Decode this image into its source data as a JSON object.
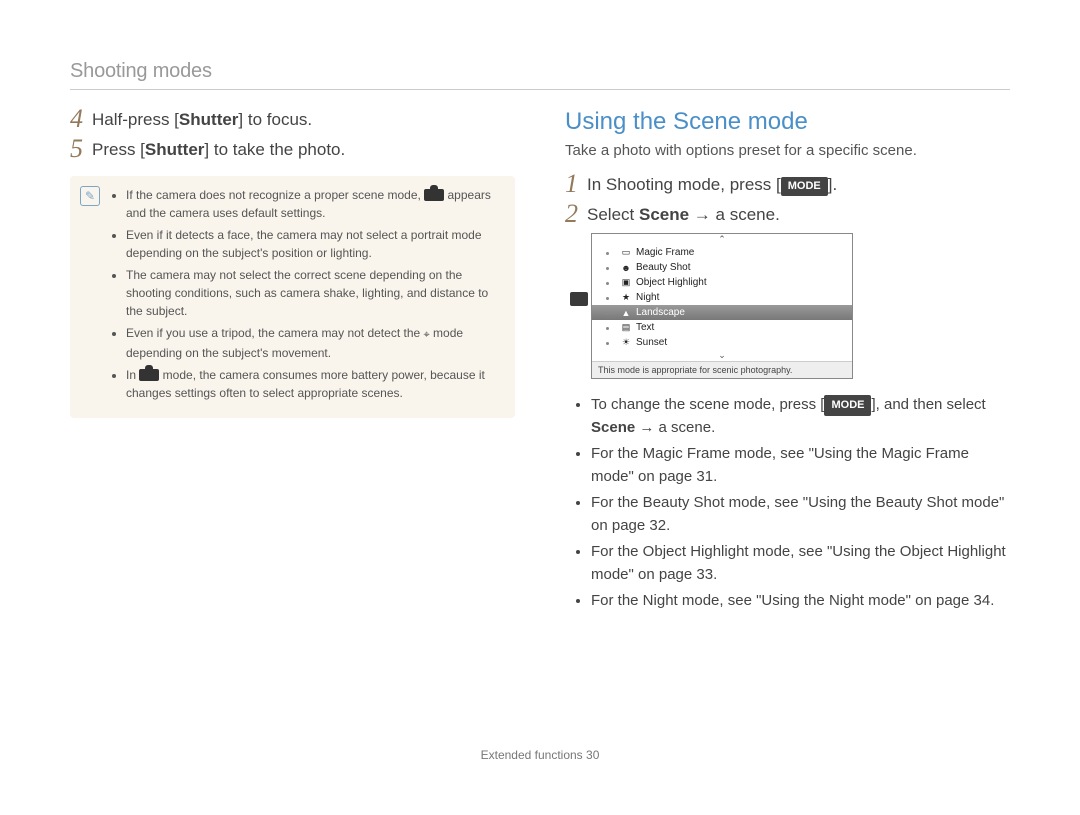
{
  "header": "Shooting modes",
  "left": {
    "steps": [
      {
        "num": "4",
        "parts": [
          "Half-press [",
          "Shutter",
          "] to focus."
        ]
      },
      {
        "num": "5",
        "parts": [
          "Press [",
          "Shutter",
          "] to take the photo."
        ]
      }
    ],
    "notes": [
      {
        "pre": "If the camera does not recognize a proper scene mode, ",
        "icon": "smart-auto-icon",
        "post": " appears and the camera uses default settings."
      },
      {
        "pre": "Even if it detects a face, the camera may not select a portrait mode depending on the subject's position or lighting."
      },
      {
        "pre": "The camera may not select the correct scene depending on the shooting conditions, such as camera shake, lighting, and distance to the subject."
      },
      {
        "pre": "Even if you use a tripod, the camera may not detect the ",
        "icon": "tripod-icon",
        "post": " mode depending on the subject's movement."
      },
      {
        "pre": "In ",
        "icon": "smart-auto-icon",
        "post": " mode, the camera consumes more battery power, because it changes settings often to select appropriate scenes."
      }
    ]
  },
  "right": {
    "title": "Using the Scene mode",
    "intro": "Take a photo with options preset for a specific scene.",
    "steps": [
      {
        "num": "1",
        "pre": "In Shooting mode, press [",
        "mode": "MODE",
        "post": "]."
      },
      {
        "num": "2",
        "pre": "Select ",
        "bold": "Scene",
        "post": " → a scene."
      }
    ],
    "scene": {
      "items": [
        {
          "ico": "▭",
          "label": "Magic Frame"
        },
        {
          "ico": "☻",
          "label": "Beauty Shot"
        },
        {
          "ico": "▣",
          "label": "Object Highlight"
        },
        {
          "ico": "★",
          "label": "Night"
        },
        {
          "ico": "▲",
          "label": "Landscape",
          "selected": true
        },
        {
          "ico": "▤",
          "label": "Text"
        },
        {
          "ico": "☀",
          "label": "Sunset"
        }
      ],
      "caption": "This mode is appropriate for scenic photography."
    },
    "bullets": [
      {
        "pre": "To change the scene mode, press [",
        "mode": "MODE",
        "mid": "], and then select ",
        "bold": "Scene",
        "post": " → a scene."
      },
      {
        "pre": "For the Magic Frame mode, see \"Using the Magic Frame mode\" on page 31."
      },
      {
        "pre": "For the Beauty Shot mode, see \"Using the Beauty Shot mode\" on page 32."
      },
      {
        "pre": "For the Object Highlight mode, see \"Using the Object Highlight mode\" on page 33."
      },
      {
        "pre": "For the Night mode, see \"Using the Night mode\" on page 34."
      }
    ]
  },
  "footer": {
    "label": "Extended functions",
    "page": "30"
  }
}
